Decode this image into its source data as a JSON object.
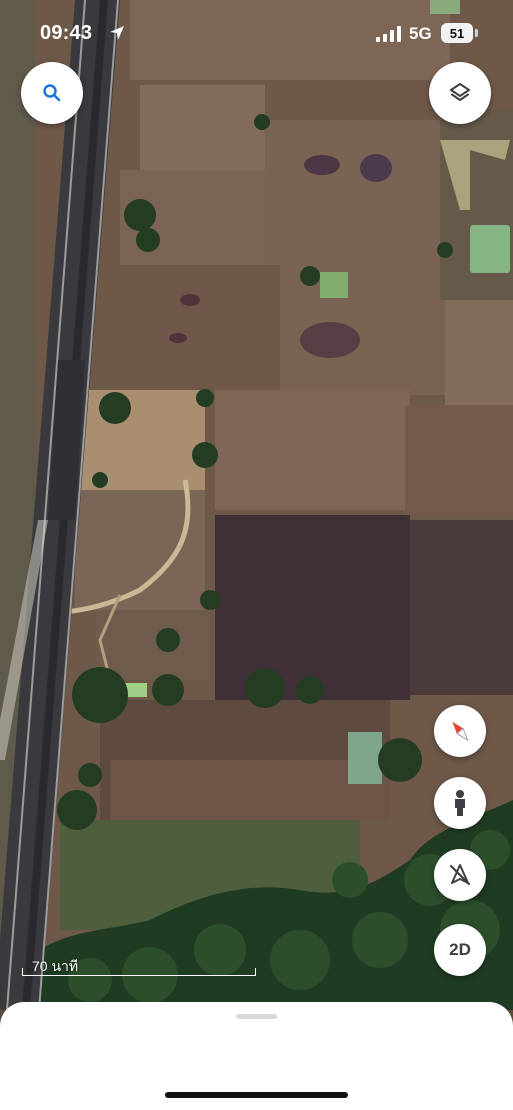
{
  "status_bar": {
    "time": "09:43",
    "network": "5G",
    "battery": "51"
  },
  "map": {
    "view": "satellite",
    "scale_label": "70 นาที"
  },
  "controls": {
    "mode_label": "2D",
    "icons": [
      "search-icon",
      "layers-icon",
      "compass-icon",
      "pegman-icon",
      "tilt-view-icon"
    ]
  },
  "colors": {
    "accent": "#1a73e8",
    "compass_red": "#ea4335"
  }
}
